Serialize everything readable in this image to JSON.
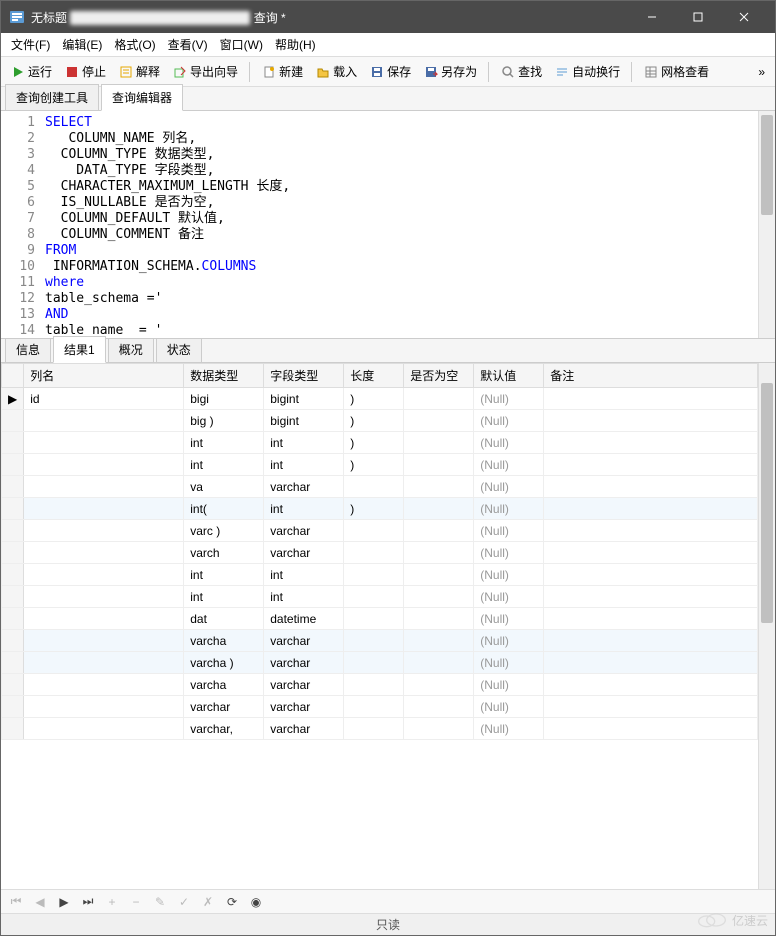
{
  "window": {
    "title_prefix": "无标题",
    "title_suffix": "查询 *"
  },
  "menu": {
    "file": "文件(F)",
    "edit": "编辑(E)",
    "format": "格式(O)",
    "view": "查看(V)",
    "window": "窗口(W)",
    "help": "帮助(H)"
  },
  "toolbar": {
    "run": "运行",
    "stop": "停止",
    "explain": "解释",
    "export_wizard": "导出向导",
    "new": "新建",
    "load": "载入",
    "save": "保存",
    "save_as": "另存为",
    "find": "查找",
    "wrap": "自动换行",
    "grid_view": "网格查看"
  },
  "upper_tabs": {
    "builder": "查询创建工具",
    "editor": "查询编辑器"
  },
  "sql_lines": [
    {
      "n": 1,
      "t": "SELECT"
    },
    {
      "n": 2,
      "t": "   COLUMN_NAME 列名,"
    },
    {
      "n": 3,
      "t": "  COLUMN_TYPE 数据类型,"
    },
    {
      "n": 4,
      "t": "    DATA_TYPE 字段类型,"
    },
    {
      "n": 5,
      "t": "  CHARACTER_MAXIMUM_LENGTH 长度,"
    },
    {
      "n": 6,
      "t": "  IS_NULLABLE 是否为空,"
    },
    {
      "n": 7,
      "t": "  COLUMN_DEFAULT 默认值,"
    },
    {
      "n": 8,
      "t": "  COLUMN_COMMENT 备注"
    },
    {
      "n": 9,
      "t": "FROM"
    },
    {
      "n": 10,
      "t": " INFORMATION_SCHEMA.COLUMNS"
    },
    {
      "n": 11,
      "t": "where"
    },
    {
      "n": 12,
      "t": "table_schema ='"
    },
    {
      "n": 13,
      "t": "AND"
    },
    {
      "n": 14,
      "t": "table name  = '"
    }
  ],
  "lower_tabs": {
    "info": "信息",
    "result": "结果1",
    "profile": "概况",
    "status": "状态"
  },
  "grid": {
    "headers": {
      "col_name": "列名",
      "data_type": "数据类型",
      "field_type": "字段类型",
      "length": "长度",
      "nullable": "是否为空",
      "default": "默认值",
      "remark": "备注"
    },
    "rows": [
      {
        "indicator": "▶",
        "name": "id",
        "dtype": "bigi",
        "ftype": "bigint",
        "len": ")",
        "null": "",
        "def": "(Null)",
        "rem": ""
      },
      {
        "indicator": "",
        "name": "",
        "dtype": "big   )",
        "ftype": "bigint",
        "len": ")",
        "null": "",
        "def": "(Null)",
        "rem": ""
      },
      {
        "indicator": "",
        "name": "",
        "dtype": "int",
        "ftype": "int",
        "len": ")",
        "null": "",
        "def": "(Null)",
        "rem": ""
      },
      {
        "indicator": "",
        "name": "",
        "dtype": "int",
        "ftype": "int",
        "len": ")",
        "null": "",
        "def": "(Null)",
        "rem": ""
      },
      {
        "indicator": "",
        "name": "",
        "dtype": "va",
        "ftype": "varchar",
        "len": "",
        "null": "",
        "def": "(Null)",
        "rem": ""
      },
      {
        "indicator": "",
        "name": "",
        "dtype": "int(",
        "ftype": "int",
        "len": ")",
        "null": "",
        "def": "(Null)",
        "rem": ""
      },
      {
        "indicator": "",
        "name": "",
        "dtype": "varc    )",
        "ftype": "varchar",
        "len": "",
        "null": "",
        "def": "(Null)",
        "rem": ""
      },
      {
        "indicator": "",
        "name": "",
        "dtype": "varch",
        "ftype": "varchar",
        "len": "",
        "null": "",
        "def": "(Null)",
        "rem": ""
      },
      {
        "indicator": "",
        "name": "",
        "dtype": "int",
        "ftype": "int",
        "len": "",
        "null": "",
        "def": "(Null)",
        "rem": ""
      },
      {
        "indicator": "",
        "name": "",
        "dtype": "int",
        "ftype": "int",
        "len": "",
        "null": "",
        "def": "(Null)",
        "rem": ""
      },
      {
        "indicator": "",
        "name": "",
        "dtype": "dat",
        "ftype": "datetime",
        "len": "",
        "null": "",
        "def": "(Null)",
        "rem": ""
      },
      {
        "indicator": "",
        "name": "",
        "dtype": "varcha",
        "ftype": "varchar",
        "len": "",
        "null": "",
        "def": "(Null)",
        "rem": ""
      },
      {
        "indicator": "",
        "name": "",
        "dtype": "varcha   )",
        "ftype": "varchar",
        "len": "",
        "null": "",
        "def": "(Null)",
        "rem": ""
      },
      {
        "indicator": "",
        "name": "",
        "dtype": "varcha",
        "ftype": "varchar",
        "len": "",
        "null": "",
        "def": "(Null)",
        "rem": ""
      },
      {
        "indicator": "",
        "name": "",
        "dtype": "varchar",
        "ftype": "varchar",
        "len": "",
        "null": "",
        "def": "(Null)",
        "rem": ""
      },
      {
        "indicator": "",
        "name": "",
        "dtype": "varchar,",
        "ftype": "varchar",
        "len": "",
        "null": "",
        "def": "(Null)",
        "rem": ""
      }
    ]
  },
  "status": {
    "readonly": "只读"
  },
  "watermark": "亿速云"
}
